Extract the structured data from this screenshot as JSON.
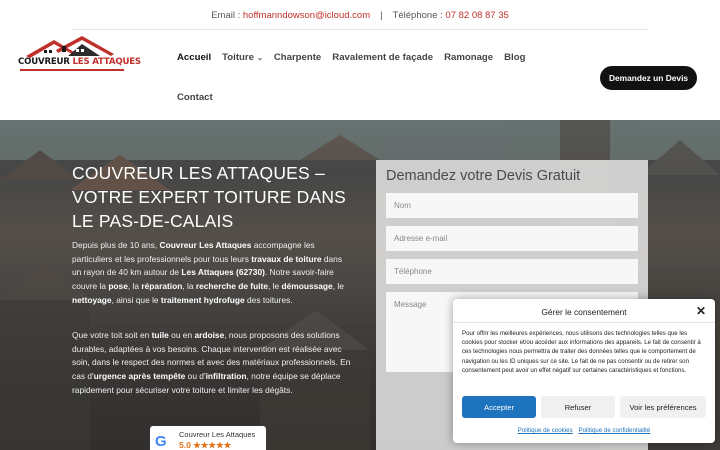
{
  "topbar": {
    "email_label": "Email :",
    "email": "hoffmanndowson@icloud.com",
    "separator": "|",
    "phone_label": "Téléphone :",
    "phone": "07 82 08 87 35"
  },
  "logo": {
    "part1": "COUVREUR",
    "part2": "LES ATTAQUES"
  },
  "nav": {
    "items": [
      "Accueil",
      "Toiture",
      "Charpente",
      "Ravalement de façade",
      "Ramonage",
      "Blog"
    ],
    "second_row": "Contact",
    "cta": "Demandez un Devis"
  },
  "hero": {
    "title": "COUVREUR LES ATTAQUES – VOTRE EXPERT TOITURE DANS LE PAS-DE-CALAIS",
    "p1": {
      "t1": "Depuis plus de 10 ans, ",
      "b1": "Couvreur Les Attaques",
      "t2": " accompagne les particuliers et les professionnels pour tous leurs ",
      "b2": "travaux de toiture",
      "t3": " dans un rayon de 40 km autour de ",
      "b3": "Les Attaques (62730)",
      "t4": ". Notre savoir-faire couvre la ",
      "b4": "pose",
      "t5": ", la ",
      "b5": "réparation",
      "t6": ", la ",
      "b6": "recherche de fuite",
      "t7": ", le ",
      "b7": "démoussage",
      "t8": ", le ",
      "b8": "nettoyage",
      "t9": ", ainsi que le ",
      "b9": "traitement hydrofuge",
      "t10": " des toitures."
    },
    "p2": {
      "t1": "Que votre toit soit en ",
      "b1": "tuile",
      "t2": " ou en ",
      "b2": "ardoise",
      "t3": ", nous proposons des solutions durables, adaptées à vos besoins. Chaque intervention est réalisée avec soin, dans le respect des normes et avec des matériaux professionnels. En cas d'",
      "b3": "urgence après tempête",
      "t4": " ou d'",
      "b4": "infiltration",
      "t5": ", notre équipe se déplace rapidement pour sécuriser votre toiture et limiter les dégâts."
    }
  },
  "google": {
    "name": "Couvreur Les Attaques",
    "rating": "5.0 ★★★★★"
  },
  "form": {
    "title": "Demandez votre Devis Gratuit",
    "name_ph": "Nom",
    "email_ph": "Adresse e-mail",
    "phone_ph": "Téléphone",
    "message_ph": "Message"
  },
  "cookie": {
    "title": "Gérer le consentement",
    "close": "✕",
    "text": "Pour offrir les meilleures expériences, nous utilisons des technologies telles que les cookies pour stocker et/ou accéder aux informations des appareils. Le fait de consentir à ces technologies nous permettra de traiter des données telles que le comportement de navigation ou les ID uniques sur ce site. Le fait de ne pas consentir ou de retirer son consentement peut avoir un effet négatif sur certaines caractéristiques et fonctions.",
    "accept": "Accepter",
    "refuse": "Refuser",
    "prefs": "Voir les préférences",
    "link1": "Politique de cookies",
    "link2": "Politique de confidentialité"
  },
  "colors": {
    "accent": "#c0302a",
    "button_dark": "#111111",
    "cookie_accept": "#1e73be"
  }
}
